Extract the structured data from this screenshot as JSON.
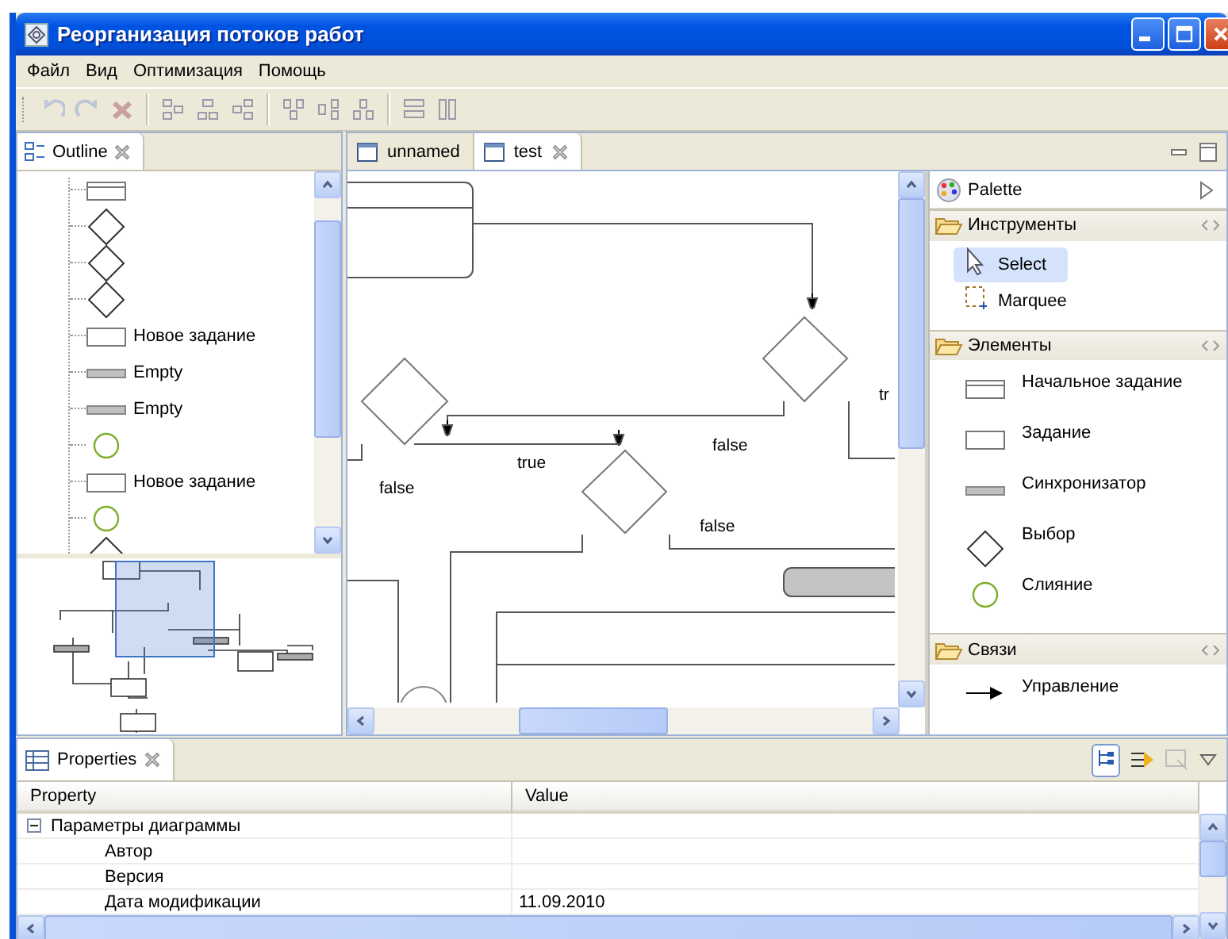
{
  "window": {
    "title": "Реорганизация потоков работ"
  },
  "menu": [
    "Файл",
    "Вид",
    "Оптимизация",
    "Помощь"
  ],
  "outline": {
    "tab": "Outline",
    "items": [
      {
        "kind": "start-task"
      },
      {
        "kind": "choice"
      },
      {
        "kind": "choice"
      },
      {
        "kind": "choice"
      },
      {
        "kind": "task",
        "label": "Новое задание"
      },
      {
        "kind": "sync",
        "label": "Empty"
      },
      {
        "kind": "sync",
        "label": "Empty"
      },
      {
        "kind": "merge"
      },
      {
        "kind": "task",
        "label": "Новое задание"
      },
      {
        "kind": "merge"
      },
      {
        "kind": "choice"
      }
    ]
  },
  "editor": {
    "tabs": [
      {
        "label": "unnamed",
        "selected": false
      },
      {
        "label": "test",
        "selected": true
      }
    ],
    "diagram": {
      "labels": [
        "tr",
        "false",
        "true",
        "false",
        "false"
      ]
    }
  },
  "palette": {
    "title": "Palette",
    "sections": [
      {
        "label": "Инструменты",
        "items": [
          {
            "kind": "select",
            "label": "Select",
            "selected": true
          },
          {
            "kind": "marquee",
            "label": "Marquee",
            "selected": false
          }
        ]
      },
      {
        "label": "Элементы",
        "items": [
          {
            "kind": "start-task",
            "label": "Начальное задание",
            "selected": false
          },
          {
            "kind": "task",
            "label": "Задание",
            "selected": false
          },
          {
            "kind": "sync",
            "label": "Синхронизатор",
            "selected": false
          },
          {
            "kind": "choice",
            "label": "Выбор",
            "selected": false
          },
          {
            "kind": "merge",
            "label": "Слияние",
            "selected": false
          }
        ]
      },
      {
        "label": "Связи",
        "items": [
          {
            "kind": "control-flow",
            "label": "Управление",
            "selected": false
          }
        ]
      }
    ]
  },
  "properties": {
    "tab": "Properties",
    "columns": [
      "Property",
      "Value"
    ],
    "groups": [
      {
        "label": "Параметры диаграммы",
        "expanded": true,
        "rows": [
          {
            "property": "Автор"
          },
          {
            "property": "Версия"
          },
          {
            "property": "Дата модификации",
            "value": "11.09.2010"
          }
        ]
      }
    ]
  }
}
